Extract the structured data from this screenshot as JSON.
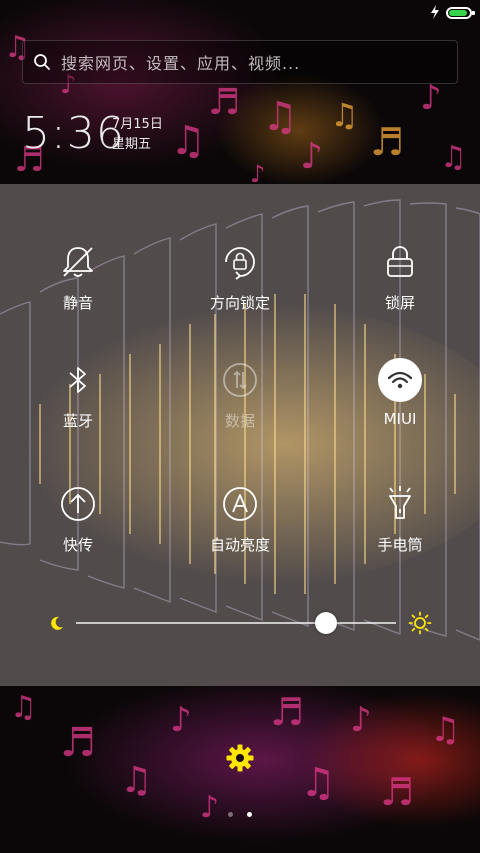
{
  "status_bar": {
    "battery_level": 0.9,
    "battery_color": "#37d34a",
    "charging_icon": "lightning-bolt-icon"
  },
  "search": {
    "placeholder": "搜索网页、设置、应用、视频..."
  },
  "clock": {
    "time": "5:36",
    "date": "7月15日",
    "weekday": "星期五"
  },
  "quick_settings": {
    "tiles": [
      {
        "label": "静音",
        "icon": "bell-muted-icon",
        "active": false
      },
      {
        "label": "方向锁定",
        "icon": "rotation-lock-icon",
        "active": false
      },
      {
        "label": "锁屏",
        "icon": "lock-icon",
        "active": false
      },
      {
        "label": "蓝牙",
        "icon": "bluetooth-icon",
        "active": false
      },
      {
        "label": "数据",
        "icon": "mobile-data-icon",
        "active": false,
        "disabled": true
      },
      {
        "label": "MIUI",
        "icon": "wifi-icon",
        "active": true
      },
      {
        "label": "快传",
        "icon": "share-upload-icon",
        "active": false
      },
      {
        "label": "自动亮度",
        "icon": "auto-brightness-icon",
        "active": false
      },
      {
        "label": "手电筒",
        "icon": "flashlight-icon",
        "active": false
      }
    ]
  },
  "brightness": {
    "level": 0.78,
    "min_icon": "moon-icon",
    "max_icon": "sun-icon",
    "accent_color": "#ffe600"
  },
  "bottom": {
    "settings_icon": "gear-icon",
    "settings_color": "#ffe600",
    "page_count": 2,
    "current_page": 2
  }
}
